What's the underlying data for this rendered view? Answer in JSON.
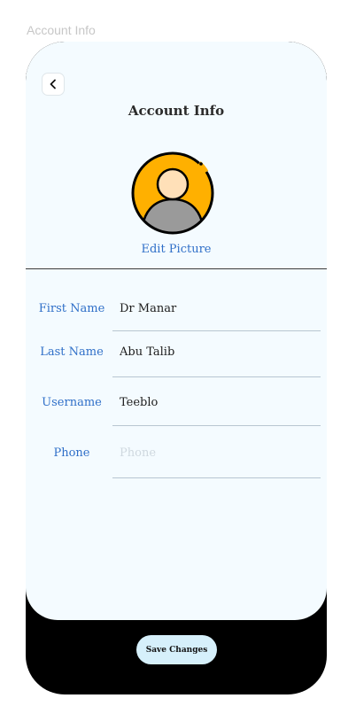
{
  "frame": {
    "label": "Account Info"
  },
  "header": {
    "title": "Account Info",
    "back_icon": "chevron-left-icon"
  },
  "profile": {
    "avatar_icon": "user-avatar-icon",
    "avatar_colors": {
      "ring": "#FFB000",
      "skin": "#FFE0B8",
      "shirt": "#9A9A9A",
      "outline": "#000000"
    },
    "edit_label": "Edit Picture"
  },
  "form": {
    "fields": [
      {
        "label": "First Name",
        "value": "Dr Manar",
        "placeholder": ""
      },
      {
        "label": "Last Name",
        "value": "Abu Talib",
        "placeholder": ""
      },
      {
        "label": "Username",
        "value": "Teeblo",
        "placeholder": ""
      },
      {
        "label": "Phone",
        "value": "",
        "placeholder": "Phone"
      }
    ]
  },
  "footer": {
    "save_label": "Save Changes"
  },
  "colors": {
    "accent": "#2F6FC8",
    "screen_bg": "#F4FBFF",
    "device": "#000000",
    "button_bg": "#D6F0FB"
  }
}
